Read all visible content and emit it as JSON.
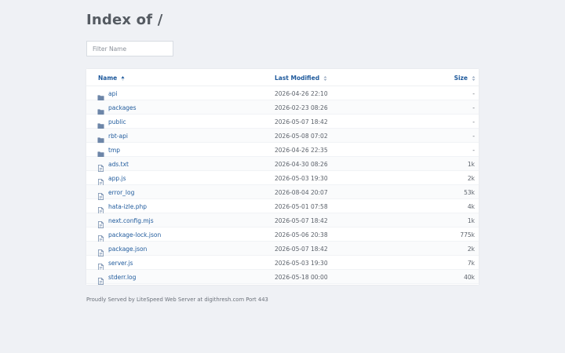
{
  "page": {
    "title": "Index of /"
  },
  "filter": {
    "placeholder": "Filter Name",
    "value": ""
  },
  "table": {
    "columns": {
      "name": "Name",
      "modified": "Last Modified",
      "size": "Size"
    },
    "rows": [
      {
        "type": "folder",
        "icon": "folder-icon",
        "name": "api",
        "modified": "2026-04-26 22:10",
        "size": "-"
      },
      {
        "type": "folder",
        "icon": "folder-icon",
        "name": "packages",
        "modified": "2026-02-23 08:26",
        "size": "-"
      },
      {
        "type": "folder",
        "icon": "folder-icon",
        "name": "public",
        "modified": "2026-05-07 18:42",
        "size": "-"
      },
      {
        "type": "folder",
        "icon": "folder-icon",
        "name": "rbt-api",
        "modified": "2026-05-08 07:02",
        "size": "-"
      },
      {
        "type": "folder",
        "icon": "folder-icon",
        "name": "tmp",
        "modified": "2026-04-26 22:35",
        "size": "-"
      },
      {
        "type": "file",
        "icon": "file-icon",
        "name": "ads.txt",
        "modified": "2026-04-30 08:26",
        "size": "1k"
      },
      {
        "type": "file",
        "icon": "file-icon",
        "name": "app.js",
        "modified": "2026-05-03 19:30",
        "size": "2k"
      },
      {
        "type": "file",
        "icon": "file-icon",
        "name": "error_log",
        "modified": "2026-08-04 20:07",
        "size": "53k"
      },
      {
        "type": "file",
        "icon": "file-icon",
        "name": "hata-izle.php",
        "modified": "2026-05-01 07:58",
        "size": "4k"
      },
      {
        "type": "file",
        "icon": "file-icon",
        "name": "next.config.mjs",
        "modified": "2026-05-07 18:42",
        "size": "1k"
      },
      {
        "type": "file",
        "icon": "file-icon",
        "name": "package-lock.json",
        "modified": "2026-05-06 20:38",
        "size": "775k"
      },
      {
        "type": "file",
        "icon": "file-icon",
        "name": "package.json",
        "modified": "2026-05-07 18:42",
        "size": "2k"
      },
      {
        "type": "file",
        "icon": "file-icon",
        "name": "server.js",
        "modified": "2026-05-03 19:30",
        "size": "7k"
      },
      {
        "type": "file",
        "icon": "file-icon",
        "name": "stderr.log",
        "modified": "2026-05-18 00:00",
        "size": "40k"
      }
    ]
  },
  "footer": {
    "text": "Proudly Served by LiteSpeed Web Server at digithresh.com Port 443"
  },
  "colors": {
    "background": "#eff1f5",
    "link": "#1f5a9c",
    "icon": "#6d86a8"
  }
}
